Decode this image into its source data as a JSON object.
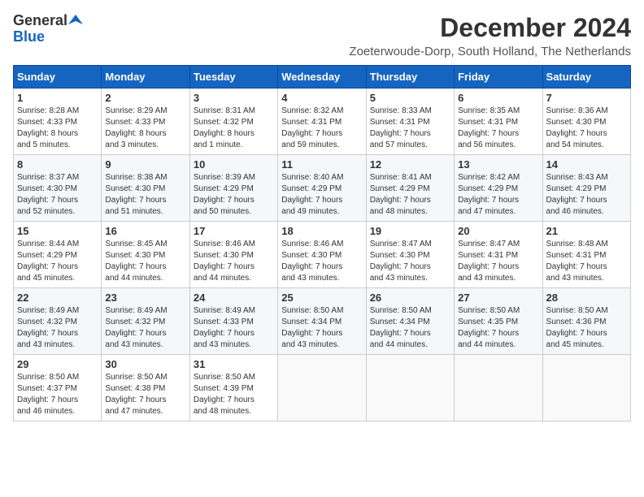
{
  "header": {
    "logo_general": "General",
    "logo_blue": "Blue",
    "title": "December 2024",
    "subtitle": "Zoeterwoude-Dorp, South Holland, The Netherlands"
  },
  "days_of_week": [
    "Sunday",
    "Monday",
    "Tuesday",
    "Wednesday",
    "Thursday",
    "Friday",
    "Saturday"
  ],
  "weeks": [
    [
      {
        "day": "1",
        "info": "Sunrise: 8:28 AM\nSunset: 4:33 PM\nDaylight: 8 hours\nand 5 minutes."
      },
      {
        "day": "2",
        "info": "Sunrise: 8:29 AM\nSunset: 4:33 PM\nDaylight: 8 hours\nand 3 minutes."
      },
      {
        "day": "3",
        "info": "Sunrise: 8:31 AM\nSunset: 4:32 PM\nDaylight: 8 hours\nand 1 minute."
      },
      {
        "day": "4",
        "info": "Sunrise: 8:32 AM\nSunset: 4:31 PM\nDaylight: 7 hours\nand 59 minutes."
      },
      {
        "day": "5",
        "info": "Sunrise: 8:33 AM\nSunset: 4:31 PM\nDaylight: 7 hours\nand 57 minutes."
      },
      {
        "day": "6",
        "info": "Sunrise: 8:35 AM\nSunset: 4:31 PM\nDaylight: 7 hours\nand 56 minutes."
      },
      {
        "day": "7",
        "info": "Sunrise: 8:36 AM\nSunset: 4:30 PM\nDaylight: 7 hours\nand 54 minutes."
      }
    ],
    [
      {
        "day": "8",
        "info": "Sunrise: 8:37 AM\nSunset: 4:30 PM\nDaylight: 7 hours\nand 52 minutes."
      },
      {
        "day": "9",
        "info": "Sunrise: 8:38 AM\nSunset: 4:30 PM\nDaylight: 7 hours\nand 51 minutes."
      },
      {
        "day": "10",
        "info": "Sunrise: 8:39 AM\nSunset: 4:29 PM\nDaylight: 7 hours\nand 50 minutes."
      },
      {
        "day": "11",
        "info": "Sunrise: 8:40 AM\nSunset: 4:29 PM\nDaylight: 7 hours\nand 49 minutes."
      },
      {
        "day": "12",
        "info": "Sunrise: 8:41 AM\nSunset: 4:29 PM\nDaylight: 7 hours\nand 48 minutes."
      },
      {
        "day": "13",
        "info": "Sunrise: 8:42 AM\nSunset: 4:29 PM\nDaylight: 7 hours\nand 47 minutes."
      },
      {
        "day": "14",
        "info": "Sunrise: 8:43 AM\nSunset: 4:29 PM\nDaylight: 7 hours\nand 46 minutes."
      }
    ],
    [
      {
        "day": "15",
        "info": "Sunrise: 8:44 AM\nSunset: 4:29 PM\nDaylight: 7 hours\nand 45 minutes."
      },
      {
        "day": "16",
        "info": "Sunrise: 8:45 AM\nSunset: 4:30 PM\nDaylight: 7 hours\nand 44 minutes."
      },
      {
        "day": "17",
        "info": "Sunrise: 8:46 AM\nSunset: 4:30 PM\nDaylight: 7 hours\nand 44 minutes."
      },
      {
        "day": "18",
        "info": "Sunrise: 8:46 AM\nSunset: 4:30 PM\nDaylight: 7 hours\nand 43 minutes."
      },
      {
        "day": "19",
        "info": "Sunrise: 8:47 AM\nSunset: 4:30 PM\nDaylight: 7 hours\nand 43 minutes."
      },
      {
        "day": "20",
        "info": "Sunrise: 8:47 AM\nSunset: 4:31 PM\nDaylight: 7 hours\nand 43 minutes."
      },
      {
        "day": "21",
        "info": "Sunrise: 8:48 AM\nSunset: 4:31 PM\nDaylight: 7 hours\nand 43 minutes."
      }
    ],
    [
      {
        "day": "22",
        "info": "Sunrise: 8:49 AM\nSunset: 4:32 PM\nDaylight: 7 hours\nand 43 minutes."
      },
      {
        "day": "23",
        "info": "Sunrise: 8:49 AM\nSunset: 4:32 PM\nDaylight: 7 hours\nand 43 minutes."
      },
      {
        "day": "24",
        "info": "Sunrise: 8:49 AM\nSunset: 4:33 PM\nDaylight: 7 hours\nand 43 minutes."
      },
      {
        "day": "25",
        "info": "Sunrise: 8:50 AM\nSunset: 4:34 PM\nDaylight: 7 hours\nand 43 minutes."
      },
      {
        "day": "26",
        "info": "Sunrise: 8:50 AM\nSunset: 4:34 PM\nDaylight: 7 hours\nand 44 minutes."
      },
      {
        "day": "27",
        "info": "Sunrise: 8:50 AM\nSunset: 4:35 PM\nDaylight: 7 hours\nand 44 minutes."
      },
      {
        "day": "28",
        "info": "Sunrise: 8:50 AM\nSunset: 4:36 PM\nDaylight: 7 hours\nand 45 minutes."
      }
    ],
    [
      {
        "day": "29",
        "info": "Sunrise: 8:50 AM\nSunset: 4:37 PM\nDaylight: 7 hours\nand 46 minutes."
      },
      {
        "day": "30",
        "info": "Sunrise: 8:50 AM\nSunset: 4:38 PM\nDaylight: 7 hours\nand 47 minutes."
      },
      {
        "day": "31",
        "info": "Sunrise: 8:50 AM\nSunset: 4:39 PM\nDaylight: 7 hours\nand 48 minutes."
      },
      {
        "day": "",
        "info": ""
      },
      {
        "day": "",
        "info": ""
      },
      {
        "day": "",
        "info": ""
      },
      {
        "day": "",
        "info": ""
      }
    ]
  ]
}
